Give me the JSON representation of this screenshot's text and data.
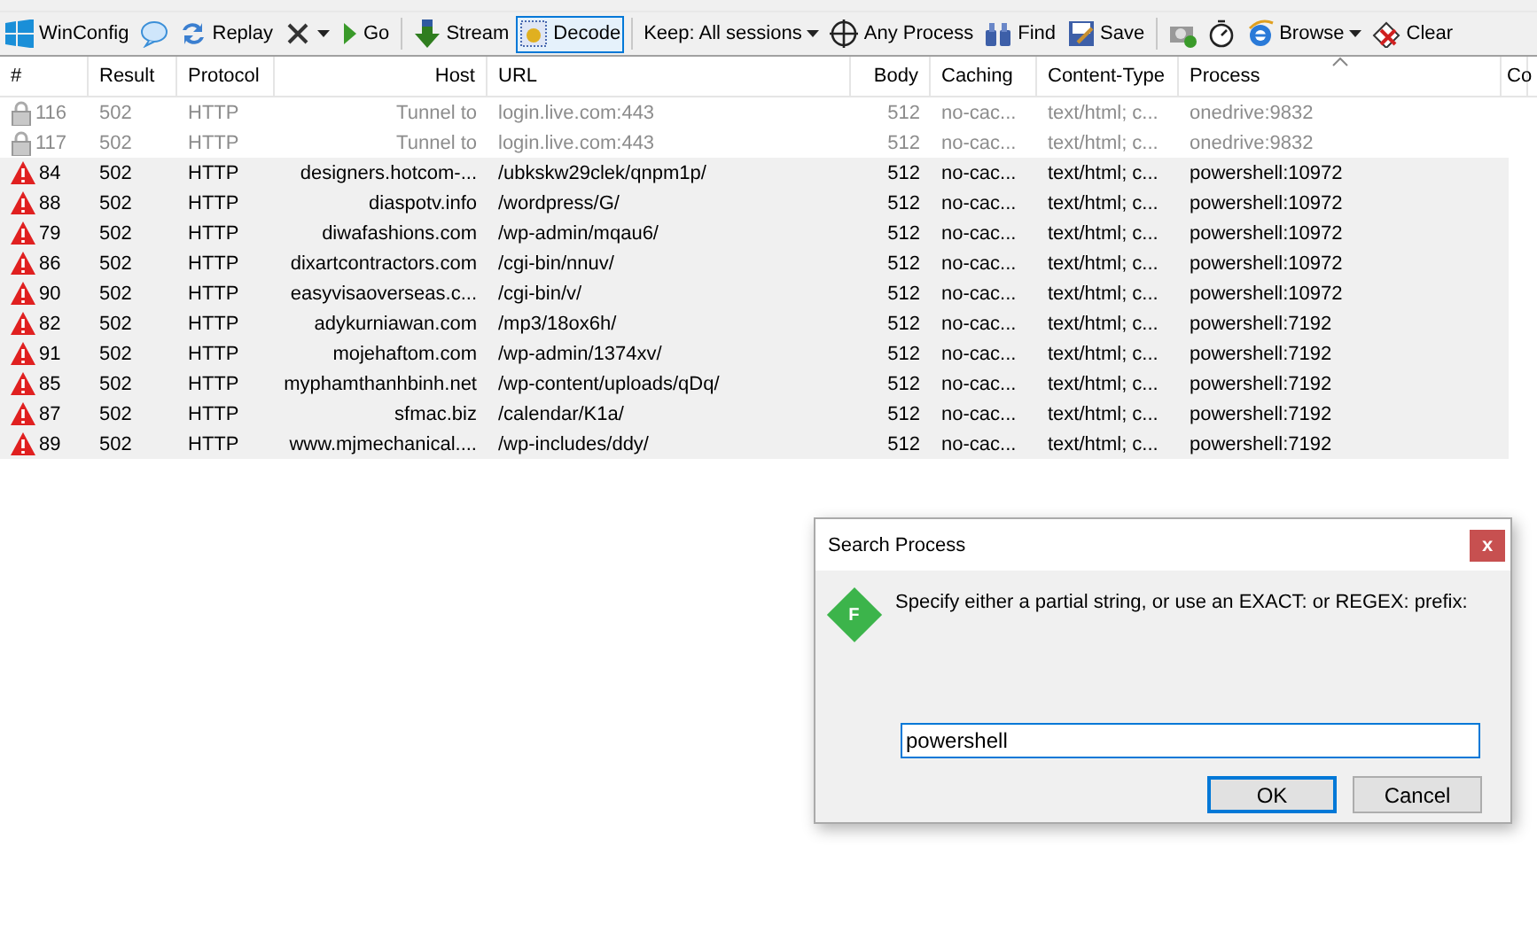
{
  "toolbar": [
    {
      "kind": "button",
      "label": "WinConfig"
    },
    {
      "kind": "icon"
    },
    {
      "kind": "button",
      "label": "Replay"
    },
    {
      "kind": "menu"
    },
    {
      "kind": "button",
      "label": "Go"
    },
    {
      "kind": "separator"
    },
    {
      "kind": "toggle",
      "label": "Stream",
      "selected": false
    },
    {
      "kind": "toggle",
      "label": "Decode",
      "selected": true
    },
    {
      "kind": "separator"
    },
    {
      "kind": "menu",
      "label": "Keep: All sessions"
    },
    {
      "kind": "button",
      "label": "Any Process"
    },
    {
      "kind": "button",
      "label": "Find"
    },
    {
      "kind": "button",
      "label": "Save"
    },
    {
      "kind": "separator"
    },
    {
      "kind": "icon"
    },
    {
      "kind": "icon"
    },
    {
      "kind": "menu",
      "label": "Browse"
    },
    {
      "kind": "button",
      "label": "Clear"
    }
  ],
  "table": {
    "columns": [
      {
        "label": "#",
        "sorted": false
      },
      {
        "label": "Result",
        "sorted": false
      },
      {
        "label": "Protocol",
        "sorted": false
      },
      {
        "label": "Host",
        "sorted": false
      },
      {
        "label": "URL",
        "sorted": false
      },
      {
        "label": "Body",
        "sorted": false
      },
      {
        "label": "Caching",
        "sorted": false
      },
      {
        "label": "Content-Type",
        "sorted": false
      },
      {
        "label": "Process",
        "sorted": true
      },
      {
        "label": "Co",
        "sorted": false
      }
    ],
    "rows": [
      {
        "kind": "tunnel",
        "id": "116",
        "result": "502",
        "protocol": "HTTP",
        "host": "Tunnel to",
        "url": "login.live.com:443",
        "body": "512",
        "caching": "no-cac...",
        "content_type": "text/html; c...",
        "process": "onedrive:9832"
      },
      {
        "kind": "tunnel",
        "id": "117",
        "result": "502",
        "protocol": "HTTP",
        "host": "Tunnel to",
        "url": "login.live.com:443",
        "body": "512",
        "caching": "no-cac...",
        "content_type": "text/html; c...",
        "process": "onedrive:9832"
      },
      {
        "kind": "error",
        "id": "84",
        "result": "502",
        "protocol": "HTTP",
        "host": "designers.hotcom-...",
        "url": "/ubkskw29clek/qnpm1p/",
        "body": "512",
        "caching": "no-cac...",
        "content_type": "text/html; c...",
        "process": "powershell:10972"
      },
      {
        "kind": "error",
        "id": "88",
        "result": "502",
        "protocol": "HTTP",
        "host": "diaspotv.info",
        "url": "/wordpress/G/",
        "body": "512",
        "caching": "no-cac...",
        "content_type": "text/html; c...",
        "process": "powershell:10972"
      },
      {
        "kind": "error",
        "id": "79",
        "result": "502",
        "protocol": "HTTP",
        "host": "diwafashions.com",
        "url": "/wp-admin/mqau6/",
        "body": "512",
        "caching": "no-cac...",
        "content_type": "text/html; c...",
        "process": "powershell:10972"
      },
      {
        "kind": "error",
        "id": "86",
        "result": "502",
        "protocol": "HTTP",
        "host": "dixartcontractors.com",
        "url": "/cgi-bin/nnuv/",
        "body": "512",
        "caching": "no-cac...",
        "content_type": "text/html; c...",
        "process": "powershell:10972"
      },
      {
        "kind": "error",
        "id": "90",
        "result": "502",
        "protocol": "HTTP",
        "host": "easyvisaoverseas.c...",
        "url": "/cgi-bin/v/",
        "body": "512",
        "caching": "no-cac...",
        "content_type": "text/html; c...",
        "process": "powershell:10972"
      },
      {
        "kind": "error",
        "id": "82",
        "result": "502",
        "protocol": "HTTP",
        "host": "adykurniawan.com",
        "url": "/mp3/18ox6h/",
        "body": "512",
        "caching": "no-cac...",
        "content_type": "text/html; c...",
        "process": "powershell:7192"
      },
      {
        "kind": "error",
        "id": "91",
        "result": "502",
        "protocol": "HTTP",
        "host": "mojehaftom.com",
        "url": "/wp-admin/1374xv/",
        "body": "512",
        "caching": "no-cac...",
        "content_type": "text/html; c...",
        "process": "powershell:7192"
      },
      {
        "kind": "error",
        "id": "85",
        "result": "502",
        "protocol": "HTTP",
        "host": "myphamthanhbinh.net",
        "url": "/wp-content/uploads/qDq/",
        "body": "512",
        "caching": "no-cac...",
        "content_type": "text/html; c...",
        "process": "powershell:7192"
      },
      {
        "kind": "error",
        "id": "87",
        "result": "502",
        "protocol": "HTTP",
        "host": "sfmac.biz",
        "url": "/calendar/K1a/",
        "body": "512",
        "caching": "no-cac...",
        "content_type": "text/html; c...",
        "process": "powershell:7192"
      },
      {
        "kind": "error",
        "id": "89",
        "result": "502",
        "protocol": "HTTP",
        "host": "www.mjmechanical....",
        "url": "/wp-includes/ddy/",
        "body": "512",
        "caching": "no-cac...",
        "content_type": "text/html; c...",
        "process": "powershell:7192"
      }
    ]
  },
  "dialog": {
    "title": "Search Process",
    "close": "x",
    "logo": "F",
    "message": "Specify either a partial string, or use an EXACT: or REGEX: prefix:",
    "value": "powershell",
    "buttons": [
      {
        "label": "OK",
        "default": true
      },
      {
        "label": "Cancel",
        "default": false
      }
    ]
  }
}
